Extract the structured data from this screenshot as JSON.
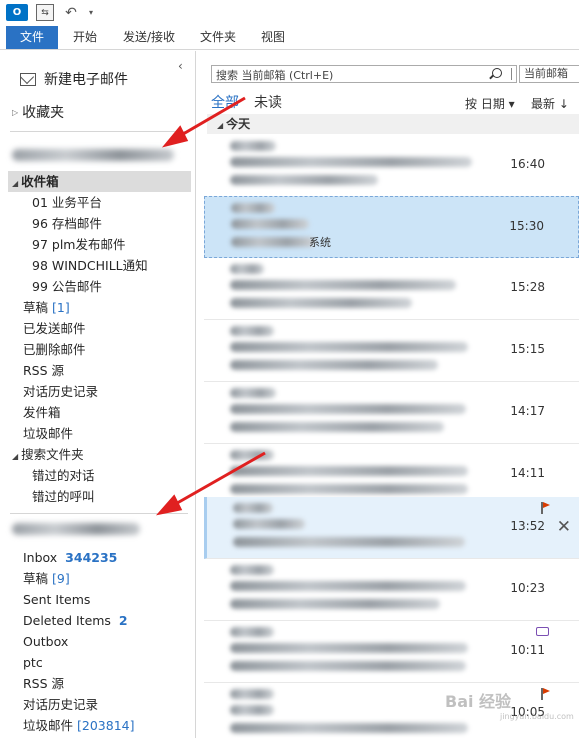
{
  "quick_access": {
    "logo": "O",
    "sendrecv": "⇆",
    "undo": "↶",
    "more": "▾"
  },
  "ribbon": {
    "tabs": [
      "文件",
      "开始",
      "发送/接收",
      "文件夹",
      "视图"
    ]
  },
  "nav": {
    "new_mail": "新建电子邮件",
    "collapse": "‹",
    "favorites": "收藏夹",
    "account1": {
      "inbox": "收件箱",
      "subfolders": [
        "01 业务平台",
        "96 存档邮件",
        "97 plm发布邮件",
        "98 WINDCHILL通知",
        "99 公告邮件"
      ],
      "drafts_label": "草稿",
      "drafts_count": "[1]",
      "folders": [
        "已发送邮件",
        "已删除邮件",
        "RSS 源",
        "对话历史记录",
        "发件箱",
        "垃圾邮件"
      ],
      "search_folders": "搜索文件夹",
      "search_subfolders": [
        "错过的对话",
        "错过的呼叫"
      ]
    },
    "account2": {
      "inbox_label": "Inbox",
      "inbox_count": "344235",
      "drafts_label": "草稿",
      "drafts_count": "[9]",
      "sent": "Sent Items",
      "deleted_label": "Deleted Items",
      "deleted_count": "2",
      "outbox": "Outbox",
      "ptc": "ptc",
      "rss": "RSS 源",
      "history": "对话历史记录",
      "junk_label": "垃圾邮件",
      "junk_count": "[203814]"
    }
  },
  "list": {
    "search_placeholder": "搜索 当前邮箱 (Ctrl+E)",
    "scope": "当前邮箱",
    "filter_all": "全部",
    "filter_unread": "未读",
    "sort_by": "按 日期 ▾",
    "sort_order": "最新 ↓",
    "group_today": "今天",
    "messages": [
      {
        "time": "16:40",
        "snippet": ""
      },
      {
        "time": "15:30",
        "snippet": "系统"
      },
      {
        "time": "15:28",
        "snippet": ""
      },
      {
        "time": "15:15",
        "snippet": ""
      },
      {
        "time": "14:17",
        "snippet": ""
      },
      {
        "time": "14:11",
        "snippet": ""
      },
      {
        "time": "13:52",
        "snippet": ""
      },
      {
        "time": "10:23",
        "snippet": ""
      },
      {
        "time": "10:11",
        "snippet": ""
      },
      {
        "time": "10:05",
        "snippet": ""
      }
    ]
  },
  "watermark": {
    "main": "Bai 经验",
    "sub": "jingyan.baidu.com"
  },
  "colors": {
    "accent": "#2a72c4",
    "selection": "#cce4f7",
    "flag": "#d83b01",
    "arrow": "#e02020"
  }
}
